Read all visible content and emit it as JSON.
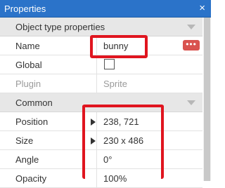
{
  "panel": {
    "title": "Properties",
    "close_glyph": "×"
  },
  "sections": {
    "object_type": {
      "label": "Object type properties"
    },
    "common": {
      "label": "Common"
    }
  },
  "rows": {
    "name": {
      "label": "Name",
      "value": "bunny"
    },
    "global": {
      "label": "Global",
      "checked": false
    },
    "plugin": {
      "label": "Plugin",
      "value": "Sprite"
    },
    "position": {
      "label": "Position",
      "value": "238, 721"
    },
    "size": {
      "label": "Size",
      "value": "230 x 486"
    },
    "angle": {
      "label": "Angle",
      "value": "0°"
    },
    "opacity": {
      "label": "Opacity",
      "value": "100%"
    }
  },
  "icons": {
    "more": "ellipsis-icon",
    "collapse": "triangle-down-icon",
    "expand": "triangle-right-icon"
  },
  "colors": {
    "titlebar": "#2b73c9",
    "highlight": "#e0151f",
    "more_button": "#d9534f"
  }
}
